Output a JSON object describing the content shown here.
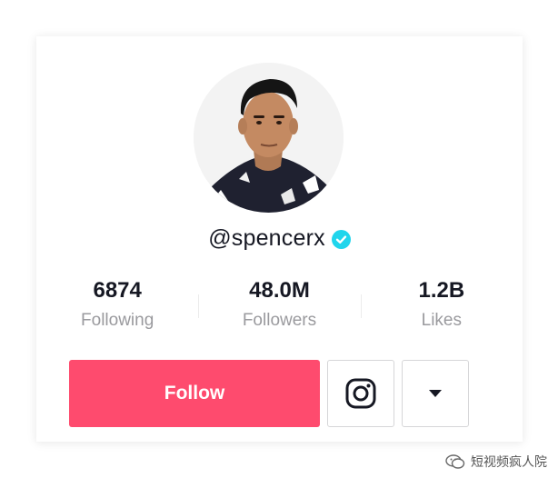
{
  "profile": {
    "username": "@spencerx",
    "verified": true,
    "avatar_icon": "profile-photo"
  },
  "stats": [
    {
      "value": "6874",
      "label": "Following"
    },
    {
      "value": "48.0M",
      "label": "Followers"
    },
    {
      "value": "1.2B",
      "label": "Likes"
    }
  ],
  "actions": {
    "follow_label": "Follow",
    "instagram_icon": "instagram-icon",
    "more_icon": "caret-down-icon"
  },
  "watermark": {
    "text": "短视频疯人院",
    "icon": "wechat-icon"
  },
  "colors": {
    "follow": "#fe2c55",
    "verified": "#20d5ec",
    "text": "#161823",
    "muted": "#9a9a9e"
  }
}
